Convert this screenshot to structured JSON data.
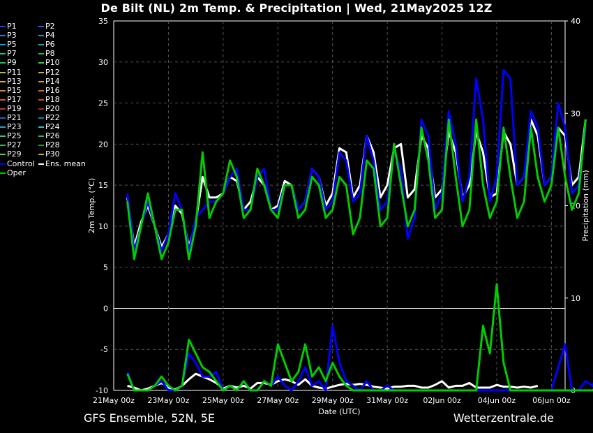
{
  "title": "De Bilt  (NL)  2m Temp. & Precipitation | Wed, 21May2025 12Z",
  "footer": {
    "left": "GFS Ensemble, 52N, 5E",
    "right": "Wetterzentrale.de"
  },
  "legend": [
    {
      "label": "P1",
      "color": "#1f3dff"
    },
    {
      "label": "P2",
      "color": "#3355ff"
    },
    {
      "label": "P3",
      "color": "#2f6fe0"
    },
    {
      "label": "P4",
      "color": "#2e86d8"
    },
    {
      "label": "P5",
      "color": "#1a9fd0"
    },
    {
      "label": "P6",
      "color": "#12b5b5"
    },
    {
      "label": "P7",
      "color": "#10c090"
    },
    {
      "label": "P8",
      "color": "#19b86e"
    },
    {
      "label": "P9",
      "color": "#20c050"
    },
    {
      "label": "P10",
      "color": "#30d030"
    },
    {
      "label": "P11",
      "color": "#b8c020"
    },
    {
      "label": "P12",
      "color": "#c8b030"
    },
    {
      "label": "P13",
      "color": "#d0b040"
    },
    {
      "label": "P14",
      "color": "#d49a28"
    },
    {
      "label": "P15",
      "color": "#d8863a"
    },
    {
      "label": "P16",
      "color": "#d06a30"
    },
    {
      "label": "P17",
      "color": "#d05a28"
    },
    {
      "label": "P18",
      "color": "#c84a28"
    },
    {
      "label": "P19",
      "color": "#b03a20"
    },
    {
      "label": "P20",
      "color": "#a02a18"
    },
    {
      "label": "P21",
      "color": "#2a5ab8"
    },
    {
      "label": "P22",
      "color": "#1a7ab8"
    },
    {
      "label": "P23",
      "color": "#2aa0c0"
    },
    {
      "label": "P24",
      "color": "#40b8c8"
    },
    {
      "label": "P25",
      "color": "#30c0a0"
    },
    {
      "label": "P26",
      "color": "#20b890"
    },
    {
      "label": "P27",
      "color": "#28b060"
    },
    {
      "label": "P28",
      "color": "#1a9848"
    },
    {
      "label": "P29",
      "color": "#58c828"
    },
    {
      "label": "P30",
      "color": "#a8b818"
    },
    {
      "label": "Control",
      "color": "#0000ff"
    },
    {
      "label": "Ens. mean",
      "color": "#ffffff"
    },
    {
      "label": "Oper",
      "color": "#00cc00"
    }
  ],
  "chart_data": {
    "type": "line",
    "xlabel": "Date (UTC)",
    "ylabel": "2m Temp. (°C)",
    "y2label": "Precipitation (mm)",
    "ylim": [
      -10,
      35
    ],
    "y2lim": [
      0,
      40
    ],
    "yticks": [
      -10,
      -5,
      0,
      5,
      10,
      15,
      20,
      25,
      30,
      35
    ],
    "y2ticks": [
      0,
      10,
      20,
      30,
      40
    ],
    "xlim_days": [
      0,
      16.5
    ],
    "x_tick_labels": [
      "21May 00z",
      "23May 00z",
      "25May 00z",
      "27May 00z",
      "29May 00z",
      "31May 00z",
      "02Jun 00z",
      "04Jun 00z",
      "06Jun 00z"
    ],
    "grid": true,
    "step_hours": 6,
    "start": "21May 12z",
    "series": [
      {
        "name": "Ens. mean",
        "kind": "temp",
        "values": [
          13.5,
          7.5,
          10.5,
          12.5,
          10,
          7.5,
          9,
          12.5,
          11.5,
          7.5,
          10.5,
          16,
          13.5,
          13.5,
          14,
          16,
          15.5,
          12,
          13,
          16,
          15,
          12,
          12.5,
          15.5,
          15,
          12,
          13,
          17,
          16,
          12.5,
          14,
          19.5,
          19,
          13.5,
          15,
          21,
          19,
          13.5,
          15,
          19.5,
          20,
          13.5,
          14.5,
          21,
          19.5,
          13.5,
          14.5,
          21.5,
          19,
          13.5,
          15,
          21.5,
          19,
          13.5,
          14,
          21.5,
          20,
          15,
          16,
          23,
          21,
          15,
          16,
          22,
          21,
          15,
          16,
          23
        ]
      },
      {
        "name": "Control",
        "kind": "temp",
        "values": [
          14,
          7,
          10,
          13,
          10,
          7,
          9,
          14,
          12,
          7,
          11,
          12,
          13,
          13,
          14,
          16,
          17,
          12,
          12,
          16,
          17,
          12,
          12,
          15,
          15,
          12,
          13,
          17,
          16,
          12,
          13,
          19,
          18,
          13,
          14,
          21,
          18,
          12,
          13,
          19,
          17,
          8.5,
          11,
          23,
          21,
          12,
          14,
          24,
          20,
          13,
          16,
          28,
          23,
          13,
          16,
          29,
          28,
          15,
          16,
          24,
          22,
          15,
          16,
          25,
          22,
          14,
          15,
          22
        ]
      },
      {
        "name": "Oper",
        "kind": "temp",
        "values": [
          13,
          6,
          10,
          14,
          10,
          6,
          8,
          12,
          12,
          6,
          10,
          19,
          11,
          13,
          14,
          18,
          16,
          11,
          12,
          17,
          15,
          12,
          11,
          15,
          15,
          11,
          12,
          16,
          15,
          11,
          12,
          16,
          15,
          9,
          11,
          18,
          17,
          10,
          11,
          20,
          15,
          10,
          12,
          22,
          18,
          11,
          12,
          23,
          16,
          10,
          12,
          23,
          15,
          11,
          13,
          22,
          16,
          11,
          13,
          22,
          16,
          13,
          15,
          22,
          16,
          12,
          14,
          23
        ]
      },
      {
        "name": "Ens. mean",
        "kind": "precip",
        "values": [
          0.5,
          0.3,
          0,
          0.2,
          0.5,
          0.8,
          0.3,
          0.1,
          0.5,
          1.2,
          1.8,
          1.5,
          1.2,
          0.8,
          0.2,
          0.5,
          0.3,
          0.5,
          0.2,
          0.8,
          0.8,
          0.6,
          1,
          1.2,
          1,
          0.6,
          1.2,
          0.5,
          0.3,
          0.2,
          0.4,
          0.6,
          0.7,
          0.6,
          0.7,
          0.6,
          0.4,
          0.3,
          0.2,
          0.4,
          0.4,
          0.5,
          0.5,
          0.3,
          0.3,
          0.6,
          1,
          0.3,
          0.5,
          0.5,
          0.8,
          0.3,
          0.3,
          0.3,
          0.6,
          0.4,
          0.4,
          0.3,
          0.4,
          0.3,
          0.5
        ]
      },
      {
        "name": "Control",
        "kind": "precip",
        "values": [
          2,
          0,
          0,
          0,
          0.5,
          1,
          0,
          0,
          0.5,
          4,
          3,
          1.5,
          1.5,
          2,
          0,
          0.5,
          0,
          1,
          0,
          0,
          1,
          0.5,
          1.5,
          0.5,
          0,
          1,
          2.5,
          0.5,
          1,
          0,
          7,
          3,
          1,
          0.5,
          0,
          1,
          0,
          0,
          0.5,
          0,
          0,
          0,
          0,
          0,
          0,
          0,
          0,
          0,
          0,
          0,
          0,
          0,
          0,
          0,
          0,
          0,
          0,
          0,
          0,
          0,
          0,
          0,
          0,
          2.5,
          5,
          0,
          0,
          1,
          0.5,
          2
        ]
      },
      {
        "name": "Oper",
        "kind": "precip",
        "values": [
          1.8,
          0,
          0,
          0,
          0.5,
          1.5,
          0.5,
          0,
          0.5,
          5.5,
          4,
          2.5,
          2,
          1,
          0,
          0.5,
          0,
          1,
          0,
          0,
          1,
          0.5,
          5,
          3,
          1,
          2,
          5,
          1.5,
          2.5,
          1,
          3,
          1.5,
          0.5,
          0,
          0,
          0,
          0,
          0,
          0,
          0,
          0,
          0,
          0,
          0,
          0,
          0,
          0,
          0,
          0,
          0,
          0,
          0,
          7,
          4,
          11.5,
          3,
          0,
          0,
          0,
          0,
          0,
          0,
          0,
          0,
          0,
          0,
          0,
          0,
          0,
          0.5
        ]
      }
    ]
  }
}
